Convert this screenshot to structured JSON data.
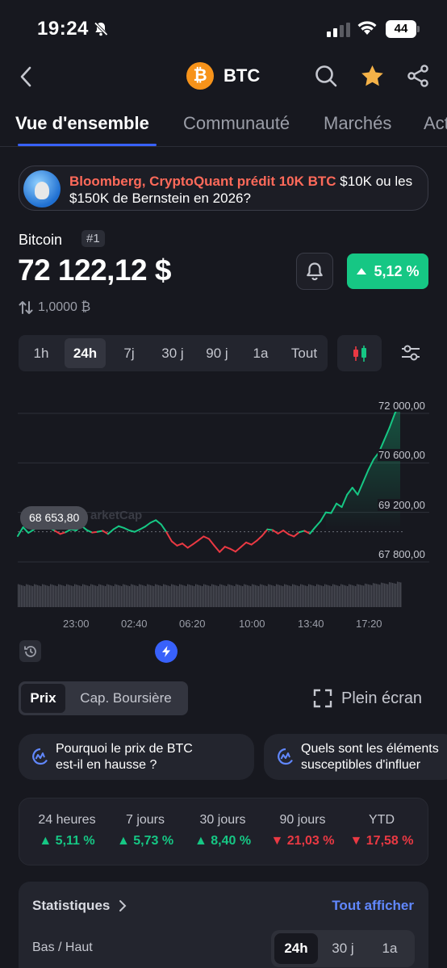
{
  "status_bar": {
    "time": "19:24",
    "battery": "44"
  },
  "header": {
    "symbol": "BTC",
    "logo_glyph": "₿"
  },
  "tabs": [
    {
      "label": "Vue d'ensemble",
      "active": true
    },
    {
      "label": "Communauté",
      "active": false
    },
    {
      "label": "Marchés",
      "active": false
    },
    {
      "label": "Actu",
      "active": false
    }
  ],
  "news": {
    "headline": "Bloomberg, CryptoQuant prédit 10K BTC",
    "rest": " $10K ou les $150K de Bernstein en 2026?"
  },
  "coin": {
    "name": "Bitcoin",
    "rank": "#1",
    "price": "72 122,12 $",
    "change_24h": "5,12 %",
    "conversion": "1,0000 ₿"
  },
  "time_ranges": [
    "1h",
    "24h",
    "7j",
    "30 j",
    "90 j",
    "1a",
    "Tout"
  ],
  "active_range": "24h",
  "chart_data": {
    "type": "line",
    "y_ticks": [
      "72 000,00",
      "70 600,00",
      "69 200,00",
      "67 800,00"
    ],
    "ylim": [
      67200,
      72400
    ],
    "x_ticks": [
      "23:00",
      "02:40",
      "06:20",
      "10:00",
      "13:40",
      "17:20"
    ],
    "reference_price": 68653.8,
    "reference_label": "68 653,80",
    "series": [
      {
        "values": [
          68530,
          68780,
          68620,
          68710,
          68850,
          68900,
          68760,
          68680,
          68590,
          68640,
          68720,
          68690,
          68820,
          68700,
          68630,
          68650,
          68680,
          68590,
          68720,
          68810,
          68760,
          68690,
          68650,
          68720,
          68800,
          68910,
          68980,
          68860,
          68640,
          68380,
          68260,
          68320,
          68200,
          68300,
          68410,
          68520,
          68450,
          68260,
          68080,
          68230,
          68170,
          68090,
          68220,
          68350,
          68290,
          68400,
          68540,
          68720,
          68700,
          68600,
          68690,
          68580,
          68520,
          68640,
          68680,
          68600,
          68780,
          68950,
          69200,
          69180,
          69450,
          69350,
          69700,
          69900,
          69700,
          70050,
          70400,
          70700,
          70900,
          71250,
          71600,
          72000,
          72300
        ]
      }
    ],
    "volume_label": "",
    "colors": {
      "up": "#16c784",
      "down": "#ea3943"
    }
  },
  "price_tag": "68 653,80",
  "watermark": "arketCap",
  "toggles": {
    "price": "Prix",
    "market_cap": "Cap. Boursière",
    "fullscreen": "Plein écran"
  },
  "ai_cards": [
    "Pourquoi le prix de BTC\nest-il en hausse ?",
    "Quels sont les éléments\nsusceptibles d'influer"
  ],
  "performance": [
    {
      "label": "24 heures",
      "value": "5,11 %",
      "dir": "up"
    },
    {
      "label": "7 jours",
      "value": "5,73 %",
      "dir": "up"
    },
    {
      "label": "30 jours",
      "value": "8,40 %",
      "dir": "up"
    },
    {
      "label": "90 jours",
      "value": "21,03 %",
      "dir": "down"
    },
    {
      "label": "YTD",
      "value": "17,58 %",
      "dir": "down"
    }
  ],
  "stats": {
    "title": "Statistiques",
    "see_all": "Tout afficher",
    "row_label": "Bas / Haut",
    "periods": [
      "24h",
      "30 j",
      "1a"
    ],
    "active_period": "24h"
  }
}
